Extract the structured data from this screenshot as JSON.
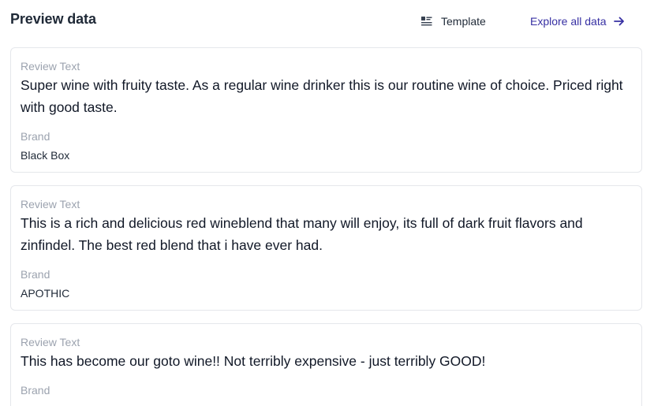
{
  "header": {
    "title": "Preview data",
    "template_label": "Template",
    "explore_label": "Explore all data",
    "template_icon": "list-layout-icon",
    "explore_icon": "arrow-right-icon",
    "accent_color": "#3730a3"
  },
  "records": [
    {
      "review_label": "Review Text",
      "review_text": "Super wine with fruity taste. As a regular wine drinker this is our routine wine of choice. Priced right with good taste.",
      "brand_label": "Brand",
      "brand": "Black Box"
    },
    {
      "review_label": "Review Text",
      "review_text": "This is a rich and delicious red wineblend that many will enjoy, its full of dark fruit flavors and zinfindel. The best red blend that i have ever had.",
      "brand_label": "Brand",
      "brand": "APOTHIC"
    },
    {
      "review_label": "Review Text",
      "review_text": "This has become our goto wine!! Not terribly expensive - just terribly GOOD!",
      "brand_label": "Brand",
      "brand": ""
    }
  ]
}
